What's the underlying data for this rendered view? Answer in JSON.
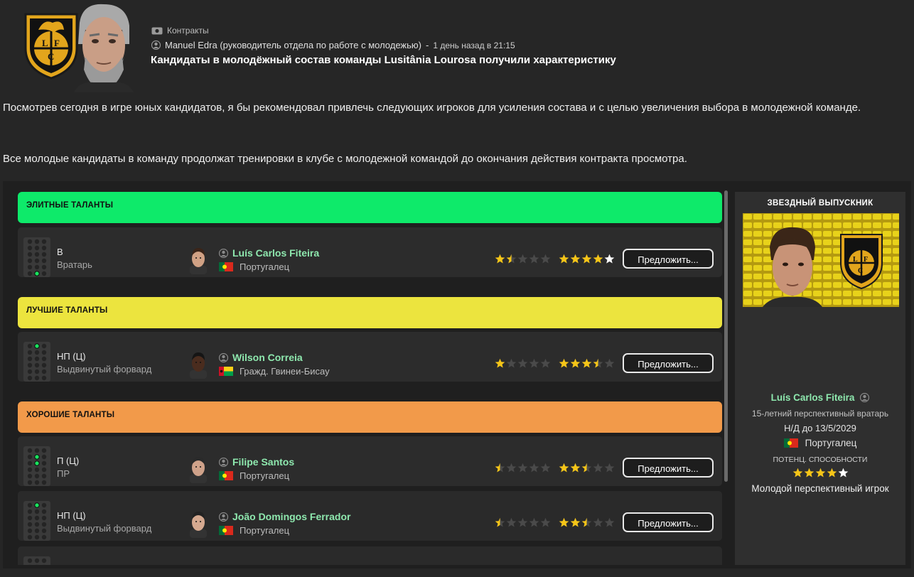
{
  "header": {
    "category": "Контракты",
    "sender": "Manuel Edra (руководитель отдела по работе с молодежью)",
    "separator": "-",
    "time": "1 день назад в 21:15",
    "title": "Кандидаты в молодёжный состав команды Lusitânia Lourosa получили характеристику",
    "club_logo_letters": "L F C"
  },
  "message": {
    "paragraph1": "Посмотрев сегодня в игре юных кандидатов, я бы рекомендовал привлечь следующих игроков для усиления состава и с целью увеличения выбора в молодежной команде.",
    "paragraph2": "Все молодые кандидаты в команду продолжат тренировки в клубе с молодежной командой до окончания действия контракта просмотра."
  },
  "categories": [
    {
      "label": "ЭЛИТНЫЕ ТАЛАНТЫ",
      "color": "#0eea6a"
    },
    {
      "label": "ЛУЧШИЕ ТАЛАНТЫ",
      "color": "#ece43e"
    },
    {
      "label": "ХОРОШИЕ ТАЛАНТЫ",
      "color": "#f29a4a"
    }
  ],
  "players": [
    {
      "position": "В",
      "role": "Вратарь",
      "name": "Luís Carlos Fiteira",
      "nationality": "Португалец",
      "flag": "portugal",
      "current_stars": 1.5,
      "potential_stars": 4.5,
      "button": "Предложить..."
    },
    {
      "position": "НП (Ц)",
      "role": "Выдвинутый форвард",
      "name": "Wilson Correia",
      "nationality": "Гражд. Гвинеи-Бисау",
      "flag": "guinea-bissau",
      "current_stars": 1,
      "potential_stars": 3.5,
      "button": "Предложить..."
    },
    {
      "position": "П (Ц)",
      "role": "ПР",
      "name": "Filipe Santos",
      "nationality": "Португалец",
      "flag": "portugal",
      "current_stars": 0.5,
      "potential_stars": 2.5,
      "button": "Предложить..."
    },
    {
      "position": "НП (Ц)",
      "role": "Выдвинутый форвард",
      "name": "João Domingos Ferrador",
      "nationality": "Португалец",
      "flag": "portugal",
      "current_stars": 0.5,
      "potential_stars": 2.5,
      "button": "Предложить..."
    }
  ],
  "star_graduate": {
    "title": "ЗВЕЗДНЫЙ ВЫПУСКНИК",
    "name": "Luís Carlos Fiteira",
    "description": "15-летний перспективный вратарь",
    "contract": "Н/Д до 13/5/2029",
    "nationality": "Португалец",
    "potential_label": "ПОТЕНЦ. СПОСОБНОСТИ",
    "potential_stars": 4.5,
    "verdict": "Молодой перспективный игрок"
  },
  "colors": {
    "accent_name": "#8ee8ae",
    "star_gold": "#f5c518",
    "star_empty": "#4a4a4a",
    "star_white": "#ffffff"
  },
  "icons": [
    "contract-icon",
    "person-icon",
    "club-crest",
    "scout-portrait"
  ]
}
